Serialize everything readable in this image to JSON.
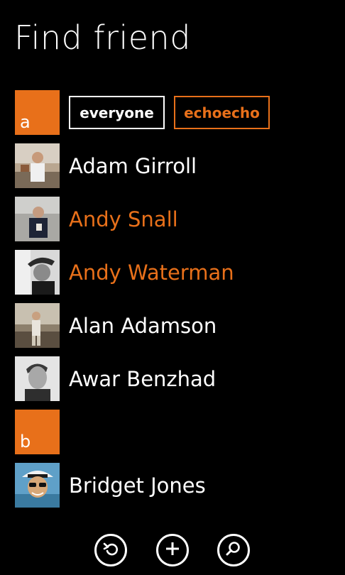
{
  "header": {
    "title": "Find friend"
  },
  "filters": {
    "everyone_label": "everyone",
    "echoecho_label": "echoecho"
  },
  "groups": [
    {
      "letter": "a"
    },
    {
      "letter": "b"
    }
  ],
  "contacts": [
    {
      "name": "Adam Girroll",
      "highlighted": false
    },
    {
      "name": "Andy Snall",
      "highlighted": true
    },
    {
      "name": "Andy Waterman",
      "highlighted": true
    },
    {
      "name": "Alan Adamson",
      "highlighted": false
    },
    {
      "name": "Awar Benzhad",
      "highlighted": false
    },
    {
      "name": "Bridget Jones",
      "highlighted": false
    }
  ],
  "appbar": {
    "buttons": [
      {
        "icon": "undo-icon"
      },
      {
        "icon": "add-icon"
      },
      {
        "icon": "search-icon"
      }
    ]
  },
  "colors": {
    "accent": "#e8701a",
    "background": "#000000",
    "text": "#ffffff"
  }
}
